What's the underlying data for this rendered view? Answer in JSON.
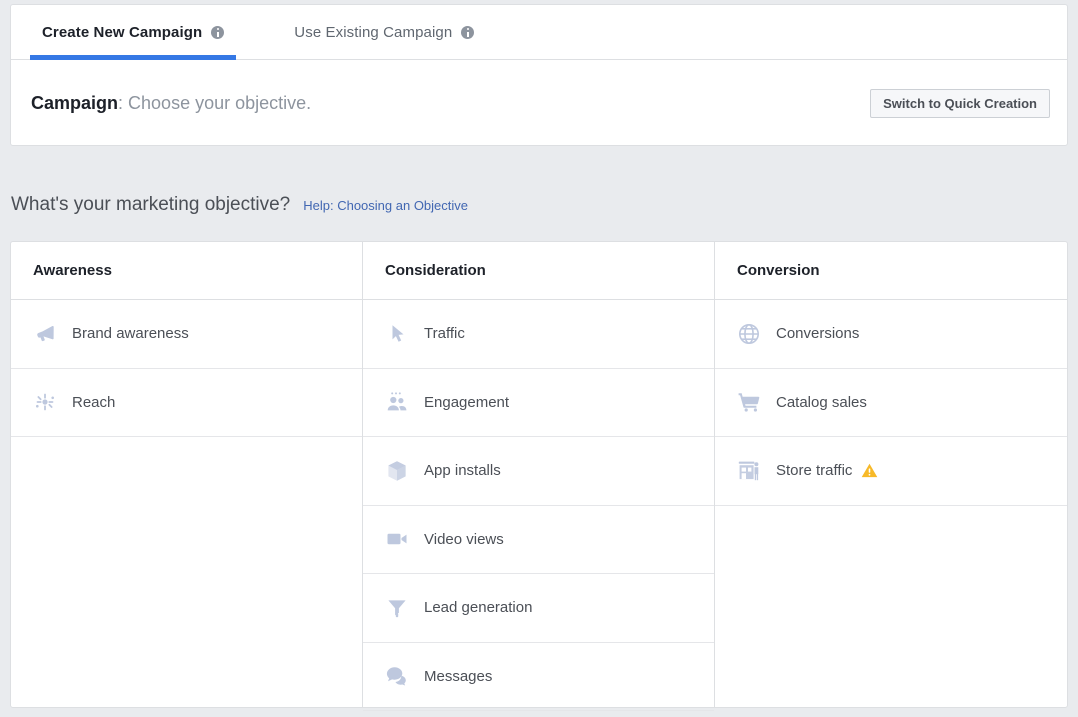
{
  "tabs": [
    {
      "label": "Create New Campaign",
      "active": true,
      "info": "info-icon"
    },
    {
      "label": "Use Existing Campaign",
      "active": false,
      "info": "info-icon"
    }
  ],
  "campaign": {
    "label": "Campaign",
    "separator": ": ",
    "instruction": "Choose your objective.",
    "switch_button": "Switch to Quick Creation"
  },
  "section": {
    "title": "What's your marketing objective?",
    "help_link": "Help: Choosing an Objective"
  },
  "colors": {
    "accent_blue": "#3578e5",
    "link_blue": "#4267b2",
    "icon_grey_blue": "#bec8de",
    "warning_amber": "#f7b928",
    "page_background": "#e9ebee",
    "card_border": "#dddfe2"
  },
  "objectives": {
    "columns": [
      {
        "header": "Awareness",
        "items": [
          {
            "label": "Brand awareness",
            "icon": "megaphone-icon",
            "warning": false
          },
          {
            "label": "Reach",
            "icon": "reach-burst-icon",
            "warning": false
          }
        ]
      },
      {
        "header": "Consideration",
        "items": [
          {
            "label": "Traffic",
            "icon": "cursor-arrow-icon",
            "warning": false
          },
          {
            "label": "Engagement",
            "icon": "people-icon",
            "warning": false
          },
          {
            "label": "App installs",
            "icon": "cube-box-icon",
            "warning": false
          },
          {
            "label": "Video views",
            "icon": "video-camera-icon",
            "warning": false
          },
          {
            "label": "Lead generation",
            "icon": "funnel-icon",
            "warning": false
          },
          {
            "label": "Messages",
            "icon": "speech-bubbles-icon",
            "warning": false
          }
        ]
      },
      {
        "header": "Conversion",
        "items": [
          {
            "label": "Conversions",
            "icon": "globe-icon",
            "warning": false
          },
          {
            "label": "Catalog sales",
            "icon": "shopping-cart-icon",
            "warning": false
          },
          {
            "label": "Store traffic",
            "icon": "storefront-icon",
            "warning": true,
            "warning_icon": "warning-triangle-icon"
          }
        ]
      }
    ]
  }
}
